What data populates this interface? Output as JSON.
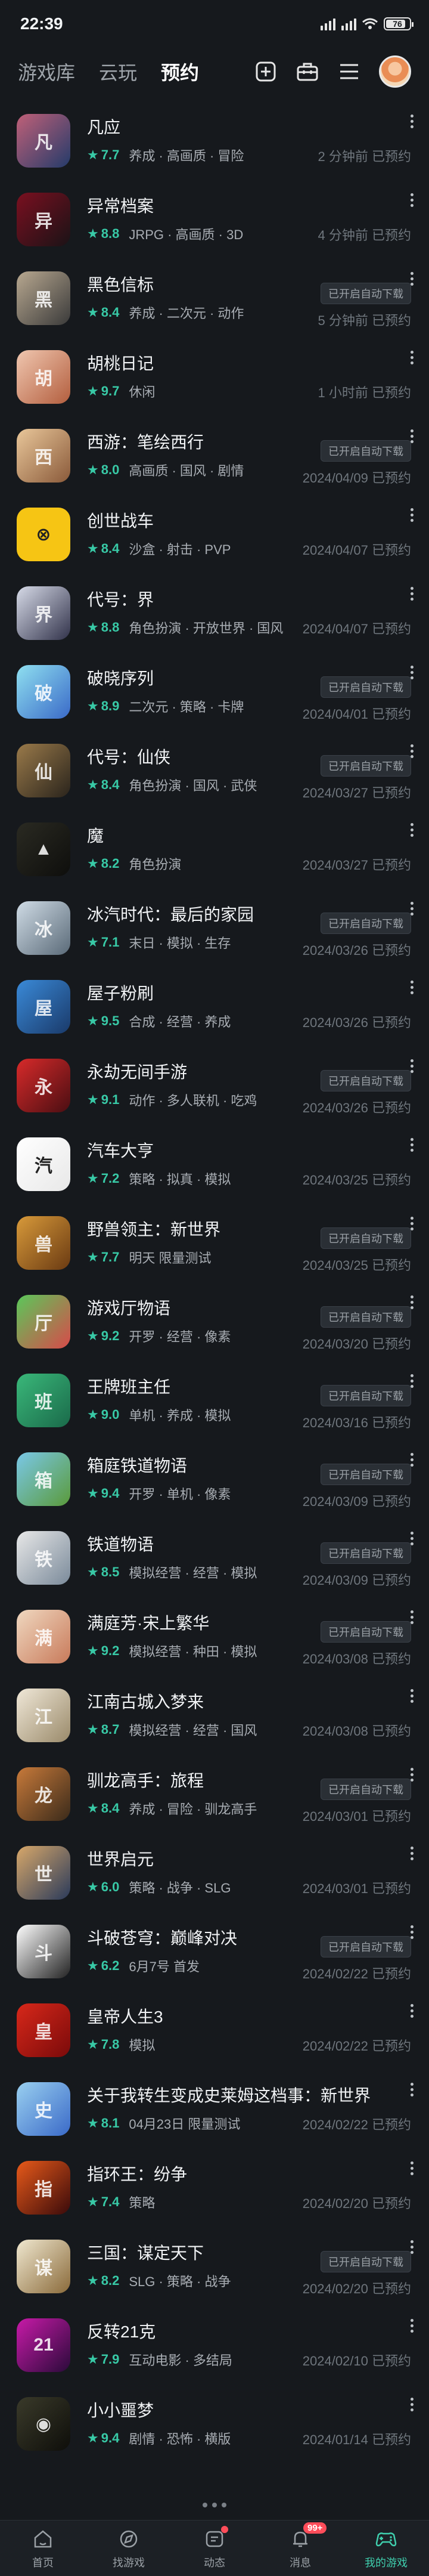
{
  "status_bar": {
    "time": "22:39",
    "battery": "76"
  },
  "top_nav": {
    "tabs": [
      {
        "label": "游戏库",
        "active": false
      },
      {
        "label": "云玩",
        "active": false
      },
      {
        "label": "预约",
        "active": true
      }
    ],
    "icons": [
      "plus-square-icon",
      "toolbox-icon",
      "menu-icon"
    ]
  },
  "auto_download_label": "已开启自动下载",
  "games": [
    {
      "name": "凡应",
      "score": "7.7",
      "tags": "养成 · 高画质 · 冒险",
      "status": "2 分钟前 已预约",
      "auto": false,
      "colors": [
        "#c06078",
        "#243b6a"
      ],
      "glyph": "凡"
    },
    {
      "name": "异常档案",
      "score": "8.8",
      "tags": "JRPG · 高画质 · 3D",
      "status": "4 分钟前 已预约",
      "auto": false,
      "colors": [
        "#7a1020",
        "#1a1216"
      ],
      "glyph": "异"
    },
    {
      "name": "黑色信标",
      "score": "8.4",
      "tags": "养成 · 二次元 · 动作",
      "status": "5 分钟前 已预约",
      "auto": true,
      "colors": [
        "#b8a890",
        "#3a3a3a"
      ],
      "glyph": "黑"
    },
    {
      "name": "胡桃日记",
      "score": "9.7",
      "tags": "休闲",
      "status": "1 小时前 已预约",
      "auto": false,
      "colors": [
        "#f0c7b0",
        "#b35e3e"
      ],
      "glyph": "胡"
    },
    {
      "name": "西游：笔绘西行",
      "score": "8.0",
      "tags": "高画质 · 国风 · 剧情",
      "status": "2024/04/09 已预约",
      "auto": true,
      "colors": [
        "#e9c79a",
        "#8a5a3a"
      ],
      "glyph": "西"
    },
    {
      "name": "创世战车",
      "score": "8.4",
      "tags": "沙盒 · 射击 · PVP",
      "status": "2024/04/07 已预约",
      "auto": false,
      "colors": [
        "#f6c514",
        "#f6c514"
      ],
      "glyph": "⊗"
    },
    {
      "name": "代号：界",
      "score": "8.8",
      "tags": "角色扮演 · 开放世界 · 国风",
      "status": "2024/04/07 已预约",
      "auto": false,
      "colors": [
        "#d7dbe8",
        "#31324a"
      ],
      "glyph": "界"
    },
    {
      "name": "破晓序列",
      "score": "8.9",
      "tags": "二次元 · 策略 · 卡牌",
      "status": "2024/04/01 已预约",
      "auto": true,
      "colors": [
        "#8fe0f0",
        "#3a6ac8"
      ],
      "glyph": "破"
    },
    {
      "name": "代号：仙侠",
      "score": "8.4",
      "tags": "角色扮演 · 国风 · 武侠",
      "status": "2024/03/27 已预约",
      "auto": true,
      "colors": [
        "#9a7a4a",
        "#2a241c"
      ],
      "glyph": "仙"
    },
    {
      "name": "魔",
      "score": "8.2",
      "tags": "角色扮演",
      "status": "2024/03/27 已预约",
      "auto": false,
      "colors": [
        "#2a2a22",
        "#0e0e0c"
      ],
      "glyph": "▲"
    },
    {
      "name": "冰汽时代：最后的家园",
      "score": "7.1",
      "tags": "末日 · 模拟 · 生存",
      "status": "2024/03/26 已预约",
      "auto": true,
      "colors": [
        "#d0dce6",
        "#5a6a78"
      ],
      "glyph": "冰"
    },
    {
      "name": "屋子粉刷",
      "score": "9.5",
      "tags": "合成 · 经营 · 养成",
      "status": "2024/03/26 已预约",
      "auto": false,
      "colors": [
        "#3a8ad8",
        "#1a3a6a"
      ],
      "glyph": "屋"
    },
    {
      "name": "永劫无间手游",
      "score": "9.1",
      "tags": "动作 · 多人联机 · 吃鸡",
      "status": "2024/03/26 已预约",
      "auto": true,
      "colors": [
        "#d82a2a",
        "#4a0e12"
      ],
      "glyph": "永"
    },
    {
      "name": "汽车大亨",
      "score": "7.2",
      "tags": "策略 · 拟真 · 模拟",
      "status": "2024/03/25 已预约",
      "auto": false,
      "colors": [
        "#ffffff",
        "#e8e8e8"
      ],
      "glyph": "汽"
    },
    {
      "name": "野兽领主：新世界",
      "score": "7.7",
      "tags": "明天 限量测试",
      "status": "2024/03/25 已预约",
      "auto": true,
      "colors": [
        "#d89a3a",
        "#6a3a12"
      ],
      "glyph": "兽"
    },
    {
      "name": "游戏厅物语",
      "score": "9.2",
      "tags": "开罗 · 经营 · 像素",
      "status": "2024/03/20 已预约",
      "auto": true,
      "colors": [
        "#5ac85a",
        "#d84a4a"
      ],
      "glyph": "厅"
    },
    {
      "name": "王牌班主任",
      "score": "9.0",
      "tags": "单机 · 养成 · 模拟",
      "status": "2024/03/16 已预约",
      "auto": true,
      "colors": [
        "#3ab87a",
        "#1a6a4a"
      ],
      "glyph": "班"
    },
    {
      "name": "箱庭铁道物语",
      "score": "9.4",
      "tags": "开罗 · 单机 · 像素",
      "status": "2024/03/09 已预约",
      "auto": true,
      "colors": [
        "#7ac8e8",
        "#5a9a3a"
      ],
      "glyph": "箱"
    },
    {
      "name": "铁道物语",
      "score": "8.5",
      "tags": "模拟经营 · 经营 · 模拟",
      "status": "2024/03/09 已预约",
      "auto": true,
      "colors": [
        "#e8e8e8",
        "#7a8a9a"
      ],
      "glyph": "铁"
    },
    {
      "name": "满庭芳·宋上繁华",
      "score": "9.2",
      "tags": "模拟经营 · 种田 · 模拟",
      "status": "2024/03/08 已预约",
      "auto": true,
      "colors": [
        "#f0d8c0",
        "#c87a5a"
      ],
      "glyph": "满"
    },
    {
      "name": "江南古城入梦来",
      "score": "8.7",
      "tags": "模拟经营 · 经营 · 国风",
      "status": "2024/03/08 已预约",
      "auto": false,
      "colors": [
        "#f0e8d8",
        "#9a8a6a"
      ],
      "glyph": "江"
    },
    {
      "name": "驯龙高手：旅程",
      "score": "8.4",
      "tags": "养成 · 冒险 · 驯龙高手",
      "status": "2024/03/01 已预约",
      "auto": true,
      "colors": [
        "#c87a3a",
        "#3a2a1a"
      ],
      "glyph": "龙"
    },
    {
      "name": "世界启元",
      "score": "6.0",
      "tags": "策略 · 战争 · SLG",
      "status": "2024/03/01 已预约",
      "auto": false,
      "colors": [
        "#d8a86a",
        "#2a3a5a"
      ],
      "glyph": "世"
    },
    {
      "name": "斗破苍穹：巅峰对决",
      "score": "6.2",
      "tags": "6月7号 首发",
      "status": "2024/02/22 已预约",
      "auto": true,
      "colors": [
        "#ffffff",
        "#222222"
      ],
      "glyph": "斗"
    },
    {
      "name": "皇帝人生3",
      "score": "7.8",
      "tags": "模拟",
      "status": "2024/02/22 已预约",
      "auto": false,
      "colors": [
        "#d8281a",
        "#7a0a0a"
      ],
      "glyph": "皇"
    },
    {
      "name": "关于我转生变成史莱姆这档事：新世界",
      "score": "8.1",
      "tags": "04月23日 限量测试",
      "status": "2024/02/22 已预约",
      "auto": false,
      "colors": [
        "#9ad0f0",
        "#3a6ac8"
      ],
      "glyph": "史"
    },
    {
      "name": "指环王：纷争",
      "score": "7.4",
      "tags": "策略",
      "status": "2024/02/20 已预约",
      "auto": false,
      "colors": [
        "#e85a1a",
        "#3a0a0a"
      ],
      "glyph": "指"
    },
    {
      "name": "三国：谋定天下",
      "score": "8.2",
      "tags": "SLG · 策略 · 战争",
      "status": "2024/02/20 已预约",
      "auto": true,
      "colors": [
        "#f0e8d0",
        "#8a6a3a"
      ],
      "glyph": "谋"
    },
    {
      "name": "反转21克",
      "score": "7.9",
      "tags": "互动电影 · 多结局",
      "status": "2024/02/10 已预约",
      "auto": false,
      "colors": [
        "#c81aa8",
        "#2a0a3a"
      ],
      "glyph": "21"
    },
    {
      "name": "小小噩梦",
      "score": "9.4",
      "tags": "剧情 · 恐怖 · 横版",
      "status": "2024/01/14 已预约",
      "auto": false,
      "colors": [
        "#3a3a2a",
        "#0e0e0a"
      ],
      "glyph": "◉"
    }
  ],
  "bottom_bar": {
    "items": [
      {
        "label": "首页",
        "icon": "home-icon",
        "active": false
      },
      {
        "label": "找游戏",
        "icon": "discover-icon",
        "active": false
      },
      {
        "label": "动态",
        "icon": "feed-icon",
        "active": false
      },
      {
        "label": "消息",
        "icon": "bell-icon",
        "active": false
      },
      {
        "label": "我的游戏",
        "icon": "gamepad-icon",
        "active": true
      }
    ],
    "message_badge": "99+"
  }
}
